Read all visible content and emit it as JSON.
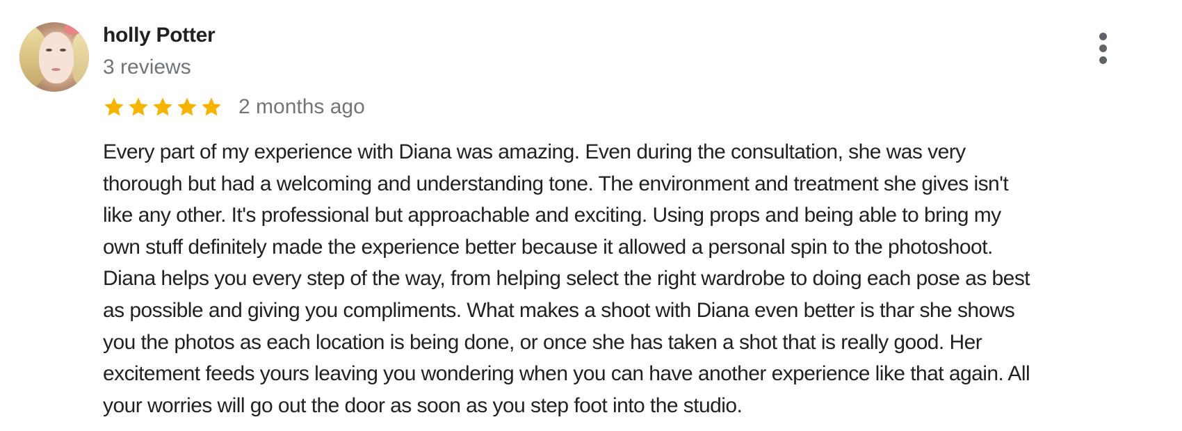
{
  "review": {
    "author_name": "holly Potter",
    "review_count": "3 reviews",
    "rating": 5,
    "rating_max": 5,
    "time_ago": "2 months ago",
    "star_color": "#f4b400",
    "avatar_icon": "user-avatar-photo",
    "more_icon": "more-vertical-icon",
    "text_lines": [
      "Every part of my experience with Diana was amazing. Even during the consultation, she was very",
      "thorough but had a welcoming and understanding tone. The environment and treatment she gives isn't",
      "like any other. It's professional but approachable and exciting. Using props and being able to bring my",
      "own stuff definitely made the experience better because it allowed a personal spin to the photoshoot.",
      "Diana helps you every step of the way, from helping select the right wardrobe to doing each pose as best",
      "as possible and giving you compliments. What makes a shoot with Diana even better is thar she shows",
      "you the photos as each location is being done, or once she has taken a shot that is really good. Her",
      "excitement feeds yours leaving you wondering when you can have another experience like that again. All",
      "your worries will go out the door as soon as you step foot into the studio."
    ]
  }
}
